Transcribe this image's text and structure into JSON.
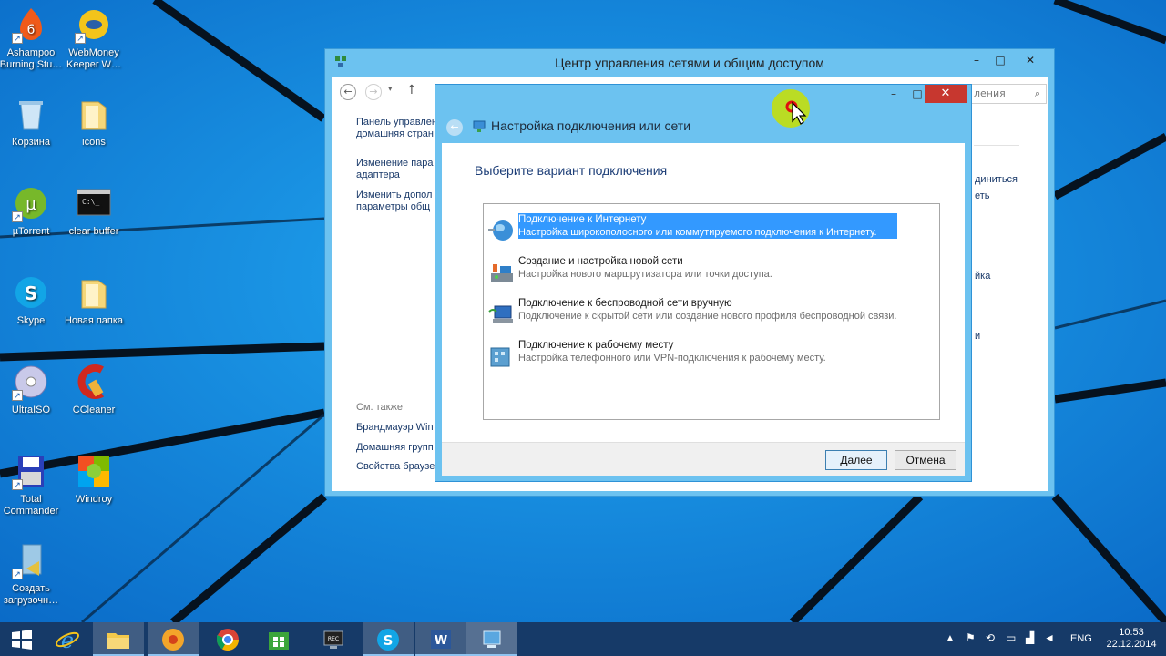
{
  "desktop": {
    "icons": [
      {
        "label": "Ashampoo Burning Stu…",
        "icon": "ashampoo-icon"
      },
      {
        "label": "WebMoney Keeper W…",
        "icon": "webmoney-icon"
      },
      {
        "label": "Корзина",
        "icon": "recycle-bin-icon"
      },
      {
        "label": "icons",
        "icon": "folder-icon"
      },
      {
        "label": "µTorrent",
        "icon": "utorrent-icon"
      },
      {
        "label": "clear buffer",
        "icon": "cmd-icon"
      },
      {
        "label": "Skype",
        "icon": "skype-icon"
      },
      {
        "label": "Новая папка",
        "icon": "folder-icon"
      },
      {
        "label": "UltraISO",
        "icon": "ultraiso-icon"
      },
      {
        "label": "CCleaner",
        "icon": "ccleaner-icon"
      },
      {
        "label": "Total Commander",
        "icon": "total-commander-icon"
      },
      {
        "label": "Windroy",
        "icon": "windroy-icon"
      },
      {
        "label": "Создать загрузочн…",
        "icon": "create-boot-icon"
      }
    ]
  },
  "net_window": {
    "title": "Центр управления сетями и общим доступом",
    "search_placeholder": "ления",
    "left_pane": {
      "link1_line1": "Панель управлен",
      "link1_line2": "домашняя стран",
      "link2_line1": "Изменение пара",
      "link2_line2": "адаптера",
      "link3_line1": "Изменить допол",
      "link3_line2": "параметры общ",
      "see_also": "См. также",
      "see1": "Брандмауэр Win",
      "see2": "Домашняя групп",
      "see3": "Свойства браузе"
    },
    "right_fragments": {
      "f1": "диниться",
      "f2": "еть",
      "f3": "йка",
      "f4": "и"
    }
  },
  "dialog": {
    "title": "Настройка подключения или сети",
    "heading": "Выберите вариант подключения",
    "options": [
      {
        "title": "Подключение к Интернету",
        "desc": "Настройка широкополосного или коммутируемого подключения к Интернету.",
        "icon": "globe-icon"
      },
      {
        "title": "Создание и настройка новой сети",
        "desc": "Настройка нового маршрутизатора или точки доступа.",
        "icon": "router-icon"
      },
      {
        "title": "Подключение к беспроводной сети вручную",
        "desc": "Подключение к скрытой сети или создание нового профиля беспроводной связи.",
        "icon": "wireless-icon"
      },
      {
        "title": "Подключение к рабочему месту",
        "desc": "Настройка телефонного или VPN-подключения к рабочему месту.",
        "icon": "workplace-icon"
      }
    ],
    "next_label": "Далее",
    "cancel_label": "Отмена"
  },
  "taskbar": {
    "items": [
      "start-icon",
      "internet-explorer-icon",
      "file-explorer-icon",
      "ashampoo-icon",
      "chrome-icon",
      "store-icon",
      "video-capture-icon",
      "skype-icon",
      "word-icon",
      "network-settings-icon"
    ],
    "lang": "ENG",
    "time": "10:53",
    "date": "22.12.2014"
  }
}
